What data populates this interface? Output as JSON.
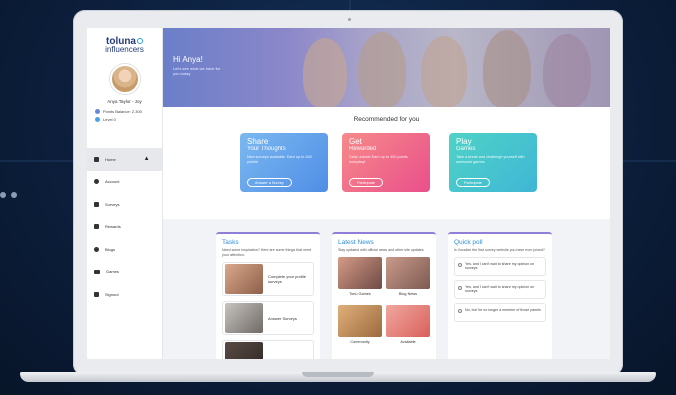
{
  "brand": {
    "logo_top": "toluna",
    "logo_bottom": "influencers"
  },
  "user": {
    "name": "Anya Taylor - Joy",
    "points": "Points Balance: 2,300",
    "level": "Level 0"
  },
  "nav": [
    {
      "label": "Home"
    },
    {
      "label": "Account"
    },
    {
      "label": "Surveys"
    },
    {
      "label": "Rewards"
    },
    {
      "label": "Blogs"
    },
    {
      "label": "Games"
    },
    {
      "label": "Signout"
    }
  ],
  "hero": {
    "greeting": "Hi Anya!",
    "subtitle": "Let's see what we have for you today"
  },
  "recommended": {
    "title": "Recommended for you",
    "cards": [
      {
        "title": "Share",
        "subtitle": "Your Thoughts",
        "text": "New surveys available. Earn up to 400 points!",
        "button": "Answer a Survey",
        "color_from": "#7bb8f0",
        "color_to": "#4f8ee6"
      },
      {
        "title": "Get",
        "subtitle": "Rewarded",
        "text": "Daily unlock! Earn up to 400 points everyday!",
        "button": "Participate",
        "color_from": "#f68a8a",
        "color_to": "#ea4f8b"
      },
      {
        "title": "Play",
        "subtitle": "Games",
        "text": "Take a break and challenge yourself with awesome games",
        "button": "Participate",
        "color_from": "#4fd3c6",
        "color_to": "#3fb6d6"
      }
    ]
  },
  "tasks": {
    "title": "Tasks",
    "text": "Need some inspiration? Here are some things that need your attention:",
    "items": [
      {
        "label": "Complete your profile surveys"
      },
      {
        "label": "Answer Surveys"
      }
    ]
  },
  "news": {
    "title": "Latest News",
    "text": "Stay updated with official news and other site updates",
    "items": [
      {
        "label": "Tonu Games"
      },
      {
        "label": "Blog News"
      },
      {
        "label": "Community"
      },
      {
        "label": "Available"
      }
    ]
  },
  "poll": {
    "title": "Quick poll",
    "question": "Is Vocalize the first survey website you have ever joined?",
    "options": [
      {
        "label": "Yes, and I can't wait to share my opinion on surveys"
      },
      {
        "label": "Yes, and I can't wait to share my opinion on surveys"
      },
      {
        "label": "No, but I'm no longer a member of those panels"
      }
    ]
  }
}
